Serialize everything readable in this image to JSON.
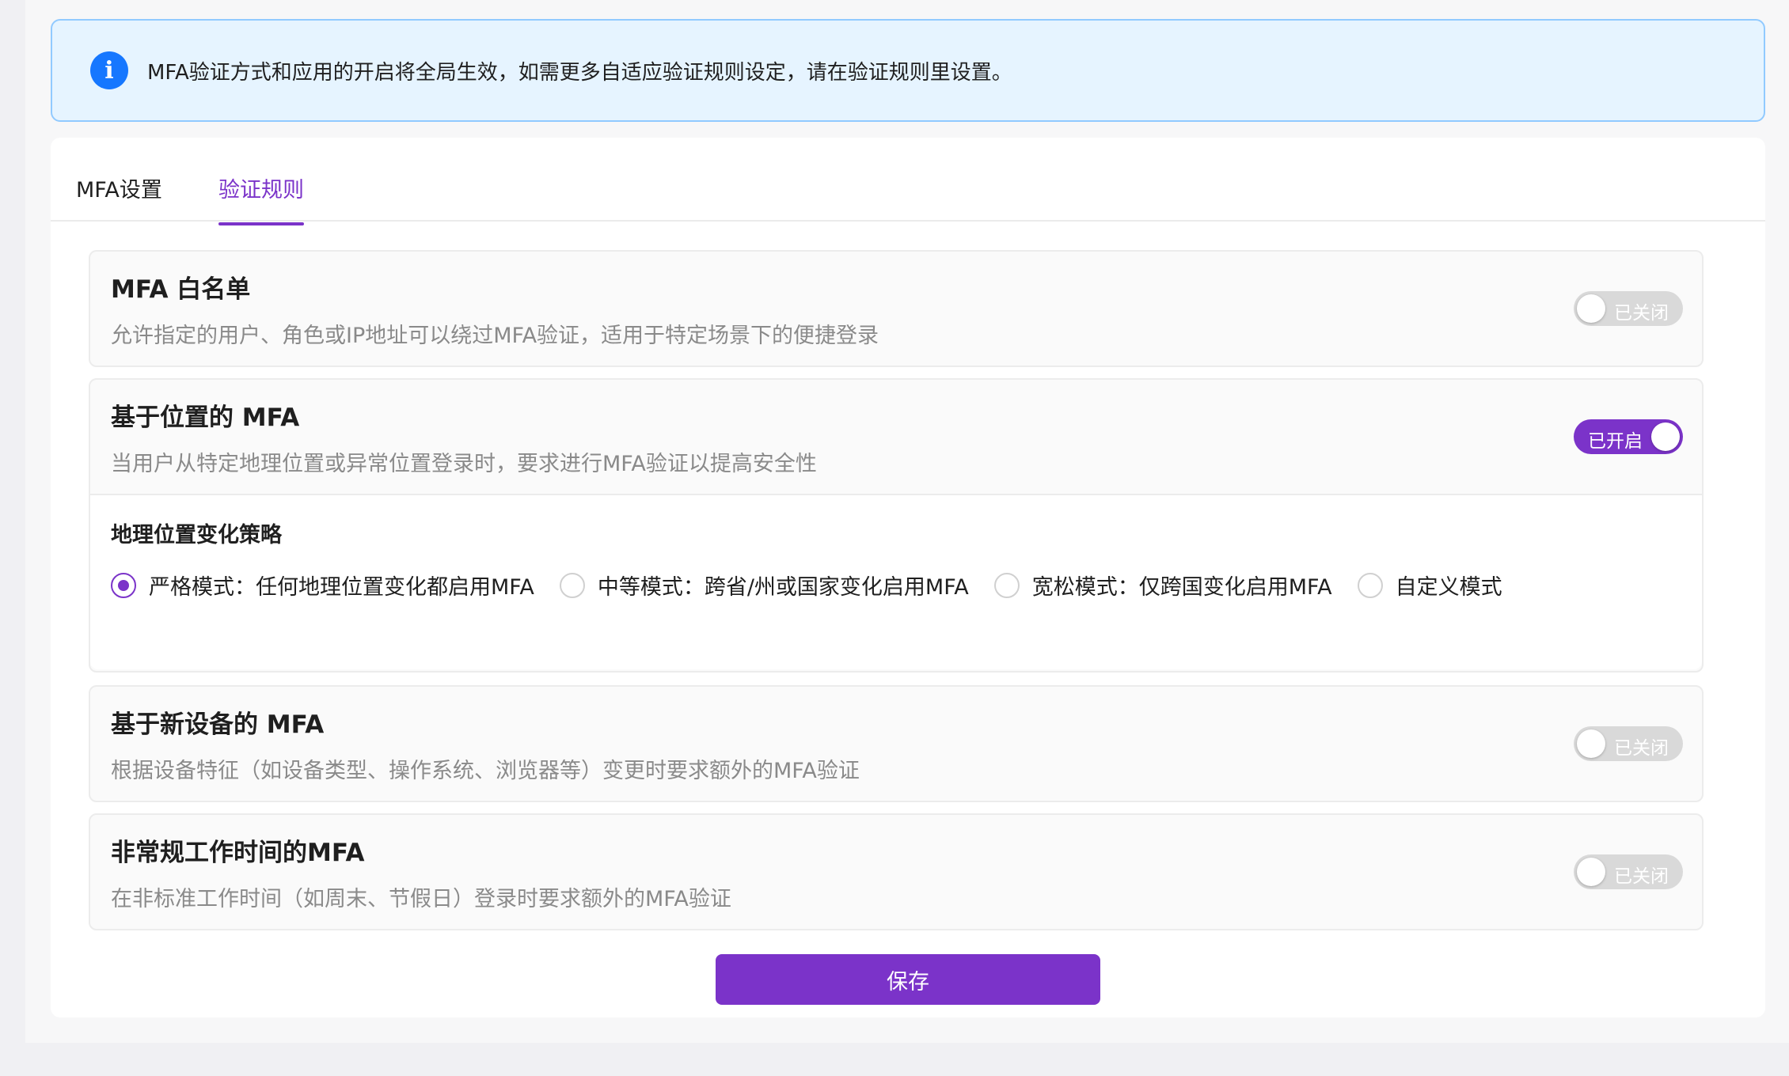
{
  "notice": {
    "text": "MFA验证方式和应用的开启将全局生效，如需更多自适应验证规则设定，请在验证规则里设置。",
    "icon": "info-icon",
    "icon_color": "#1677ff"
  },
  "tabs": [
    {
      "label": "MFA设置",
      "active": false
    },
    {
      "label": "验证规则",
      "active": true
    }
  ],
  "accent_color": "#7b33c9",
  "rules": [
    {
      "title": "MFA 白名单",
      "description": "允许指定的用户、角色或IP地址可以绕过MFA验证，适用于特定场景下的便捷登录",
      "enabled": false,
      "switch_label": "已关闭"
    },
    {
      "title": "基于位置的 MFA",
      "description": "当用户从特定地理位置或异常位置登录时，要求进行MFA验证以提高安全性",
      "enabled": true,
      "switch_label": "已开启",
      "policy": {
        "title": "地理位置变化策略",
        "options": [
          {
            "label": "严格模式：任何地理位置变化都启用MFA",
            "checked": true
          },
          {
            "label": "中等模式：跨省/州或国家变化启用MFA",
            "checked": false
          },
          {
            "label": "宽松模式：仅跨国变化启用MFA",
            "checked": false
          },
          {
            "label": "自定义模式",
            "checked": false
          }
        ]
      }
    },
    {
      "title": "基于新设备的 MFA",
      "description": "根据设备特征（如设备类型、操作系统、浏览器等）变更时要求额外的MFA验证",
      "enabled": false,
      "switch_label": "已关闭"
    },
    {
      "title": "非常规工作时间的MFA",
      "description": "在非标准工作时间（如周末、节假日）登录时要求额外的MFA验证",
      "enabled": false,
      "switch_label": "已关闭"
    }
  ],
  "save_label": "保存"
}
